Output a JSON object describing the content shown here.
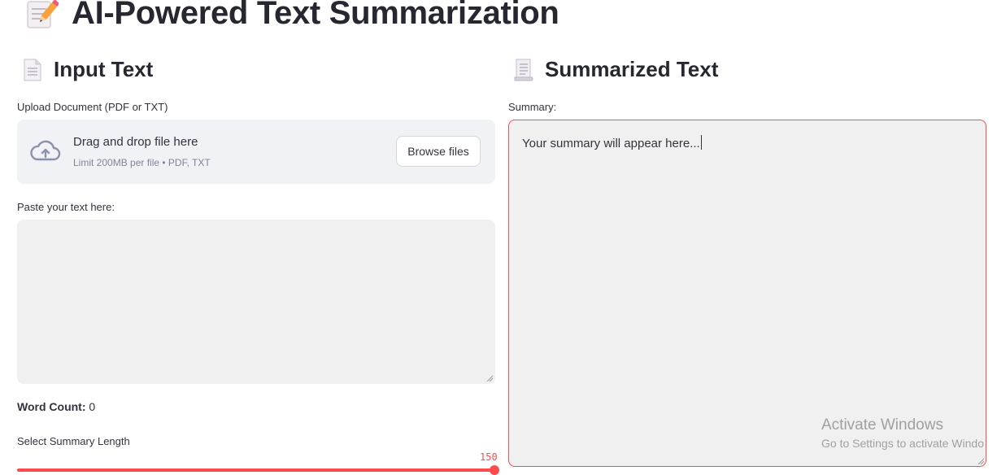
{
  "header": {
    "title": "AI-Powered Text Summarization",
    "icon": "memo-pencil-icon"
  },
  "input_panel": {
    "heading": "Input Text",
    "icon": "page-icon",
    "upload": {
      "label": "Upload Document (PDF or TXT)",
      "drop_text": "Drag and drop file here",
      "limit_text": "Limit 200MB per file • PDF, TXT",
      "browse_label": "Browse files",
      "icon": "cloud-upload-icon"
    },
    "paste": {
      "label": "Paste your text here:",
      "value": ""
    },
    "word_count": {
      "label": "Word Count:",
      "value": "0"
    },
    "summary_length": {
      "label": "Select Summary Length",
      "value": "150",
      "fill_fraction": 1.0
    }
  },
  "output_panel": {
    "heading": "Summarized Text",
    "icon": "scroll-icon",
    "summary": {
      "label": "Summary:",
      "value": "Your summary will appear here..."
    }
  },
  "watermark": {
    "line1": "Activate Windows",
    "line2": "Go to Settings to activate Windo"
  },
  "colors": {
    "accent": "#ff4b4b",
    "text": "#31333f",
    "input_bg": "#f0f0f0",
    "uploader_bg": "#f0f2f6"
  }
}
